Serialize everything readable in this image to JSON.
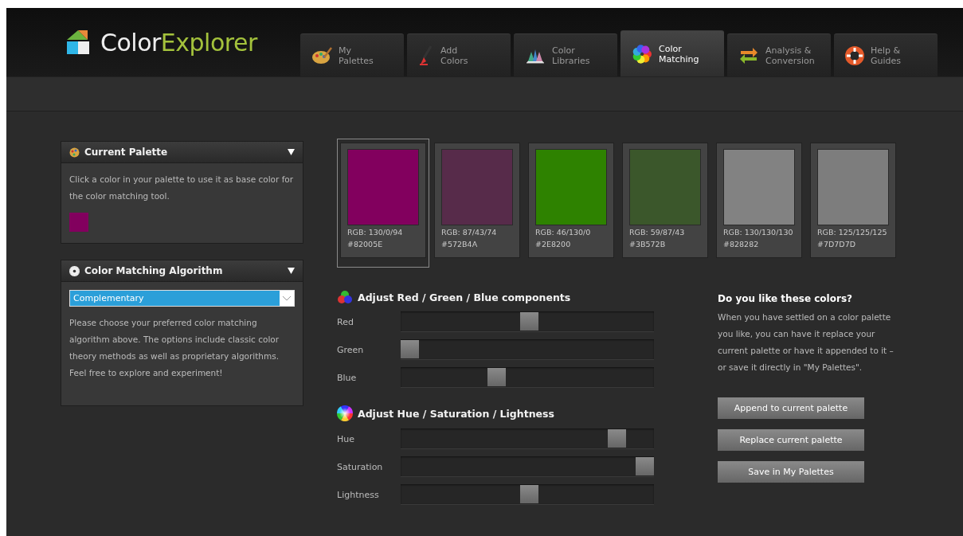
{
  "logo": {
    "part_1": "Color",
    "part_2": "Explorer"
  },
  "tabs": [
    {
      "label": "My\nPalettes",
      "selected": false
    },
    {
      "label": "Add\nColors",
      "selected": false
    },
    {
      "label": "Color\nLibraries",
      "selected": false
    },
    {
      "label": "Color\nMatching",
      "selected": true
    },
    {
      "label": "Analysis &\nConversion",
      "selected": false
    },
    {
      "label": "Help &\nGuides",
      "selected": false
    }
  ],
  "current_palette": {
    "title": "Current Palette",
    "text": "Click a color in your palette to use it as base color for the color matching tool.",
    "swatches": [
      {
        "color": "#82005e"
      }
    ]
  },
  "algorithm": {
    "title": "Color Matching Algorithm",
    "select_value": "Complementary",
    "text": "Please choose your preferred color matching algorithm above. The options include classic color theory methods as well as proprietary algorithms. Feel free to explore and experiment!"
  },
  "swatches": [
    {
      "color": "#82005e",
      "rgb": "RGB: 130/0/94",
      "hex": "#82005E",
      "selected": true
    },
    {
      "color": "#572b4a",
      "rgb": "RGB: 87/43/74",
      "hex": "#572B4A",
      "selected": false
    },
    {
      "color": "#2e8200",
      "rgb": "RGB: 46/130/0",
      "hex": "#2E8200",
      "selected": false
    },
    {
      "color": "#3b572b",
      "rgb": "RGB: 59/87/43",
      "hex": "#3B572B",
      "selected": false
    },
    {
      "color": "#828282",
      "rgb": "RGB: 130/130/130",
      "hex": "#828282",
      "selected": false
    },
    {
      "color": "#7d7d7d",
      "rgb": "RGB: 125/125/125",
      "hex": "#7D7D7D",
      "selected": false
    }
  ],
  "rgb_section": {
    "title": "Adjust Red / Green / Blue components",
    "sliders": [
      {
        "label": "Red",
        "level": 0.51
      },
      {
        "label": "Green",
        "level": 0
      },
      {
        "label": "Blue",
        "level": 0.37
      }
    ]
  },
  "hsl_section": {
    "title": "Adjust Hue / Saturation / Lightness",
    "sliders": [
      {
        "label": "Hue",
        "level": 0.88
      },
      {
        "label": "Saturation",
        "level": 1
      },
      {
        "label": "Lightness",
        "level": 0.51
      }
    ]
  },
  "like_section": {
    "title": "Do you like these colors?",
    "text": "When you have settled on a color palette you like, you can have it replace your current palette or have it appended to it – or save it directly in \"My Palettes\".",
    "buttons": [
      "Append to current palette",
      "Replace current palette",
      "Save in My Palettes"
    ]
  }
}
